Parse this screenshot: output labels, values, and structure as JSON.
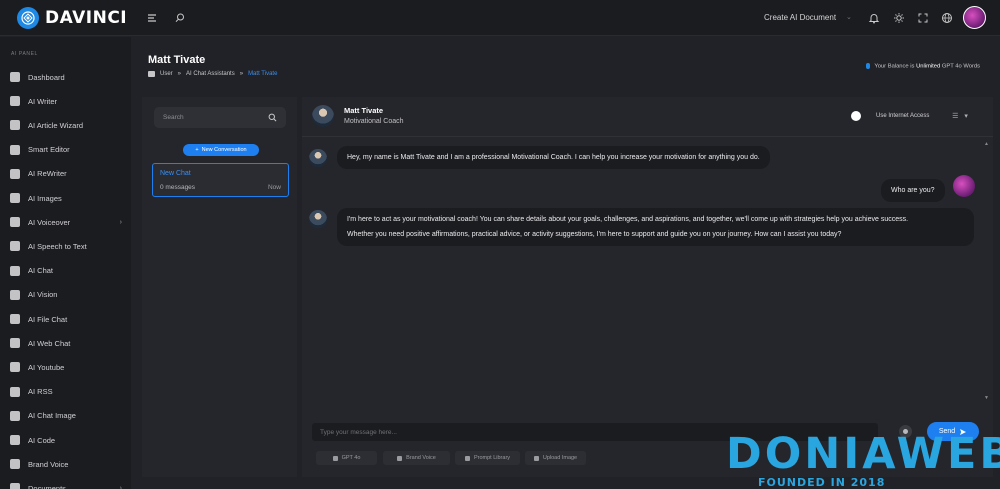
{
  "app": {
    "name": "DAVINCI"
  },
  "topbar": {
    "create_label": "Create AI Document"
  },
  "sidebar": {
    "section": "AI PANEL",
    "items": [
      {
        "label": "Dashboard",
        "icon": "grid-icon"
      },
      {
        "label": "AI Writer",
        "icon": "robot-icon"
      },
      {
        "label": "AI Article Wizard",
        "icon": "sparkle-icon"
      },
      {
        "label": "Smart Editor",
        "icon": "brush-icon"
      },
      {
        "label": "AI ReWriter",
        "icon": "edit-icon"
      },
      {
        "label": "AI Images",
        "icon": "image-icon"
      },
      {
        "label": "AI Voiceover",
        "icon": "soundwave-icon",
        "chevron": "›"
      },
      {
        "label": "AI Speech to Text",
        "icon": "transcript-icon"
      },
      {
        "label": "AI Chat",
        "icon": "chat-icon"
      },
      {
        "label": "AI Vision",
        "icon": "eye-icon"
      },
      {
        "label": "AI File Chat",
        "icon": "folder-icon"
      },
      {
        "label": "AI Web Chat",
        "icon": "globe-icon"
      },
      {
        "label": "AI Youtube",
        "icon": "youtube-icon"
      },
      {
        "label": "AI RSS",
        "icon": "rss-icon"
      },
      {
        "label": "AI Chat Image",
        "icon": "chat-image-icon"
      },
      {
        "label": "AI Code",
        "icon": "code-icon"
      },
      {
        "label": "Brand Voice",
        "icon": "megaphone-icon"
      },
      {
        "label": "Documents",
        "icon": "document-icon",
        "chevron": "›"
      }
    ]
  },
  "page": {
    "title": "Matt Tivate",
    "breadcrumb": [
      "User",
      "»",
      "AI Chat Assistants",
      "»",
      "Matt Tivate"
    ],
    "balance_prefix": "Your Balance is",
    "balance_value": "Unlimited",
    "balance_suffix": "GPT 4o Words"
  },
  "conversations": {
    "search_placeholder": "Search",
    "new_button": "New Conversation",
    "items": [
      {
        "title": "New Chat",
        "messages": "0 messages",
        "time": "Now"
      }
    ]
  },
  "chat": {
    "assistant_name": "Matt Tivate",
    "assistant_role": "Motivational Coach",
    "internet_label": "Use Internet Access",
    "messages": [
      {
        "role": "assistant",
        "text": "Hey, my name is Matt Tivate and I am a professional Motivational Coach. I can help you increase your motivation for anything you do."
      },
      {
        "role": "user",
        "text": "Who are you?"
      },
      {
        "role": "assistant",
        "line1": "I'm here to act as your motivational coach! You can share details about your goals, challenges, and aspirations, and together, we'll come up with strategies help you achieve success.",
        "line2": "Whether you need positive affirmations, practical advice, or activity suggestions, I'm here to support and guide you on your journey. How can I assist you today?"
      }
    ],
    "input_placeholder": "Type your message here...",
    "send_label": "Send",
    "tools": [
      "GPT 4o",
      "Brand Voice",
      "Prompt Library",
      "Upload Image"
    ]
  },
  "watermark": {
    "text": "DONIAWEB",
    "sub": "FOUNDED IN 2018"
  },
  "colors": {
    "accent": "#1e7ff0",
    "panel": "#25262b",
    "sidebar": "#1b1c20",
    "watermark": "#29a5e0"
  }
}
